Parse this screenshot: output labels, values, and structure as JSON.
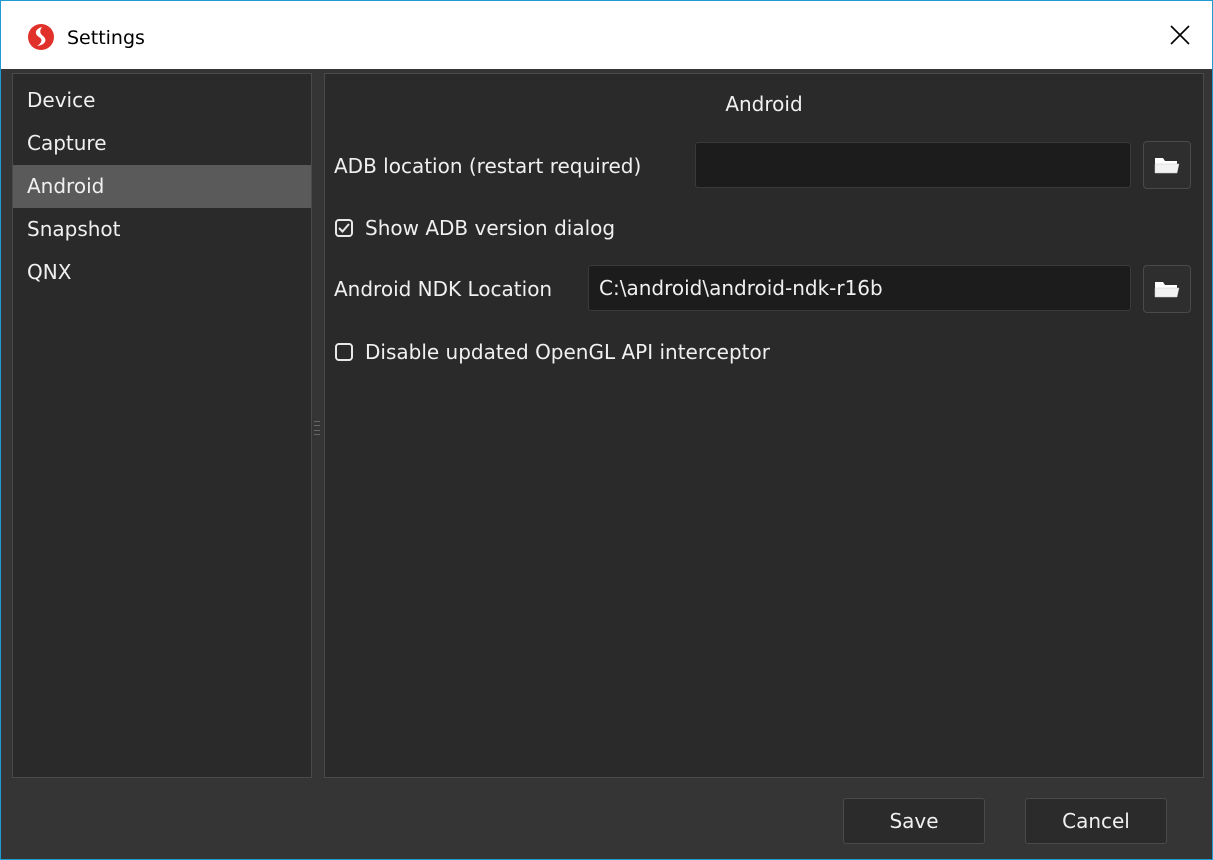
{
  "window": {
    "title": "Settings",
    "app_icon": "snapdragon-logo-icon",
    "close_icon": "close-icon"
  },
  "sidebar": {
    "items": [
      {
        "label": "Device",
        "selected": false
      },
      {
        "label": "Capture",
        "selected": false
      },
      {
        "label": "Android",
        "selected": true
      },
      {
        "label": "Snapshot",
        "selected": false
      },
      {
        "label": "QNX",
        "selected": false
      }
    ]
  },
  "main": {
    "title": "Android",
    "adb_location": {
      "label": "ADB location (restart required)",
      "value": "",
      "browse_icon": "folder-open-icon"
    },
    "show_adb_version": {
      "label": "Show ADB version dialog",
      "checked": true
    },
    "ndk_location": {
      "label": "Android NDK Location",
      "value": "C:\\android\\android-ndk-r16b",
      "browse_icon": "folder-open-icon"
    },
    "disable_opengl": {
      "label": "Disable updated OpenGL API interceptor",
      "checked": false
    }
  },
  "footer": {
    "save_label": "Save",
    "cancel_label": "Cancel"
  },
  "colors": {
    "accent": "#1f9bd1",
    "background": "#353535",
    "panel": "#2a2a2a",
    "selection": "#5a5a5a",
    "logo": "#e0322b"
  }
}
